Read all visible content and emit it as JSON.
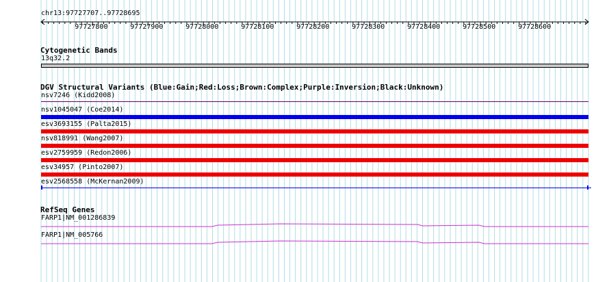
{
  "region": "chr13:97727707..97728695",
  "ruler": {
    "start": 97727707,
    "end": 97728695,
    "ticks": [
      "97727800",
      "97727900",
      "97728000",
      "97728100",
      "97728200",
      "97728300",
      "97728400",
      "97728500",
      "97728600"
    ]
  },
  "cytobands": {
    "title": "Cytogenetic Bands",
    "band": "13q32.2"
  },
  "dgv": {
    "title": "DGV Structural Variants (Blue:Gain;Red:Loss;Brown:Complex;Purple:Inversion;Black:Unknown)",
    "variants": [
      {
        "label": "nsv7246 (Kidd2008)",
        "type": "Inversion",
        "color": "#660066"
      },
      {
        "label": "nsv1045047 (Coe2014)",
        "type": "Gain",
        "color": "#0000ee"
      },
      {
        "label": "esv3693155 (Palta2015)",
        "type": "Loss",
        "color": "#ee0000"
      },
      {
        "label": "nsv818991 (Wang2007)",
        "type": "Loss",
        "color": "#ee0000"
      },
      {
        "label": "esv2759959 (Redon2006)",
        "type": "Loss",
        "color": "#ee0000"
      },
      {
        "label": "esv34957 (Pinto2007)",
        "type": "Loss",
        "color": "#ee0000"
      },
      {
        "label": "esv2568558 (McKernan2009)",
        "type": "Gain",
        "color": "#0000ee"
      }
    ]
  },
  "refseq": {
    "title": "RefSeq Genes",
    "genes": [
      {
        "label": "FARP1|NM_001286839",
        "color": "#cc33cc"
      },
      {
        "label": "FARP1|NM_005766",
        "color": "#cc33cc"
      }
    ]
  },
  "colors": {
    "grid": "#b0dce6",
    "band_fill": "#c8c8c8",
    "band_outline": "#000000"
  }
}
